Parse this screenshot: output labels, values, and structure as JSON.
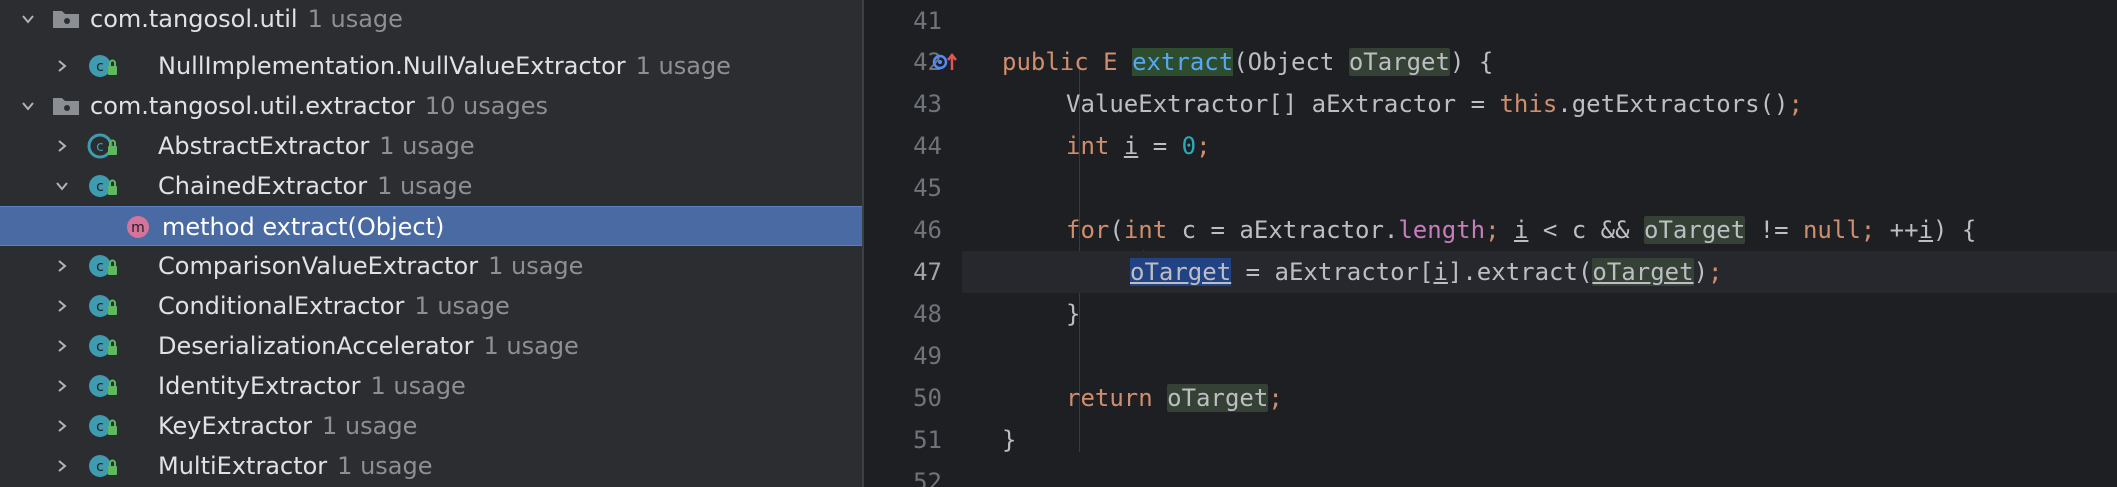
{
  "tree": {
    "rows": [
      {
        "label": "com.tangosol.util",
        "usage": "1 usage"
      },
      {
        "label": "NullImplementation.NullValueExtractor",
        "usage": "1 usage"
      },
      {
        "label": "com.tangosol.util.extractor",
        "usage": "10 usages"
      },
      {
        "label": "AbstractExtractor",
        "usage": "1 usage"
      },
      {
        "label": "ChainedExtractor",
        "usage": "1 usage"
      },
      {
        "label": "method  extract(Object)",
        "usage": ""
      },
      {
        "label": "ComparisonValueExtractor",
        "usage": "1 usage"
      },
      {
        "label": "ConditionalExtractor",
        "usage": "1 usage"
      },
      {
        "label": "DeserializationAccelerator",
        "usage": "1 usage"
      },
      {
        "label": "IdentityExtractor",
        "usage": "1 usage"
      },
      {
        "label": "KeyExtractor",
        "usage": "1 usage"
      },
      {
        "label": "MultiExtractor",
        "usage": "1 usage"
      }
    ],
    "method_badge": "m"
  },
  "editor": {
    "line_numbers": [
      "41",
      "42",
      "43",
      "44",
      "45",
      "46",
      "47",
      "48",
      "49",
      "50",
      "51",
      "52"
    ],
    "code": {
      "l42": {
        "kw_public": "public",
        "type_e": "E",
        "method": "extract",
        "open": "(Object ",
        "param": "oTarget",
        "close": ") {"
      },
      "l43": {
        "a": "ValueExtractor[] aExtractor = ",
        "this": "this",
        "b": ".getExtractors()",
        "semi": ";"
      },
      "l44": {
        "kw_int": "int",
        "sp": " ",
        "var": "i",
        "eq": " = ",
        "num": "0",
        "semi": ";"
      },
      "l46": {
        "kw_for": "for",
        "p1": "(",
        "kw_int": "int",
        "p2": " c = aExtractor.",
        "fld": "length",
        "semi1": ";",
        "sp1": " ",
        "var_i": "i",
        "p3": " < c && ",
        "otarget": "oTarget",
        "p4": " != ",
        "kw_null": "null",
        "semi2": ";",
        "p5": " ++",
        "var_i2": "i",
        "p6": ") {"
      },
      "l47": {
        "otarget": "oTarget",
        "p1": " = aExtractor[",
        "var_i": "i",
        "p2": "].extract(",
        "otarget2": "oTarget",
        "p3": ")",
        "semi": ";"
      },
      "l48": {
        "brace": "}"
      },
      "l50": {
        "kw_return": "return",
        "sp": " ",
        "otarget": "oTarget",
        "semi": ";"
      },
      "l51": {
        "brace": "}"
      }
    },
    "colors": {
      "keyword": "#cf8e6d",
      "field": "#c77dbb",
      "number": "#2aacb8",
      "selection": "#4a6aa3"
    }
  }
}
